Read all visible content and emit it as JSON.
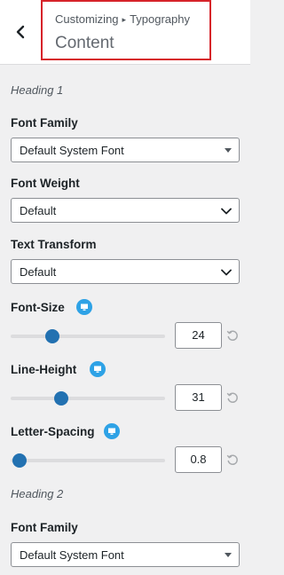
{
  "header": {
    "breadcrumb_parent": "Customizing",
    "breadcrumb_separator": "▸",
    "breadcrumb_current": "Typography",
    "title": "Content",
    "highlight_color": "#d6232a"
  },
  "heading1": {
    "section_label": "Heading 1",
    "font_family": {
      "label": "Font Family",
      "value": "Default System Font"
    },
    "font_weight": {
      "label": "Font Weight",
      "value": "Default"
    },
    "text_transform": {
      "label": "Text Transform",
      "value": "Default"
    },
    "font_size": {
      "label": "Font-Size",
      "value": "24",
      "slider_fraction": 0.27
    },
    "line_height": {
      "label": "Line-Height",
      "value": "31",
      "slider_fraction": 0.33
    },
    "letter_spacing": {
      "label": "Letter-Spacing",
      "value": "0.8",
      "slider_fraction": 0.06
    }
  },
  "heading2": {
    "section_label": "Heading 2",
    "font_family": {
      "label": "Font Family",
      "value": "Default System Font"
    }
  },
  "colors": {
    "accent": "#2271b1",
    "device_icon": "#2ea2e6",
    "panel_bg": "#f0f0f1"
  },
  "icons": {
    "back": "chevron-left-icon",
    "device": "desktop-icon",
    "reset": "reset-icon",
    "dropdown": "chevron-down-icon"
  }
}
